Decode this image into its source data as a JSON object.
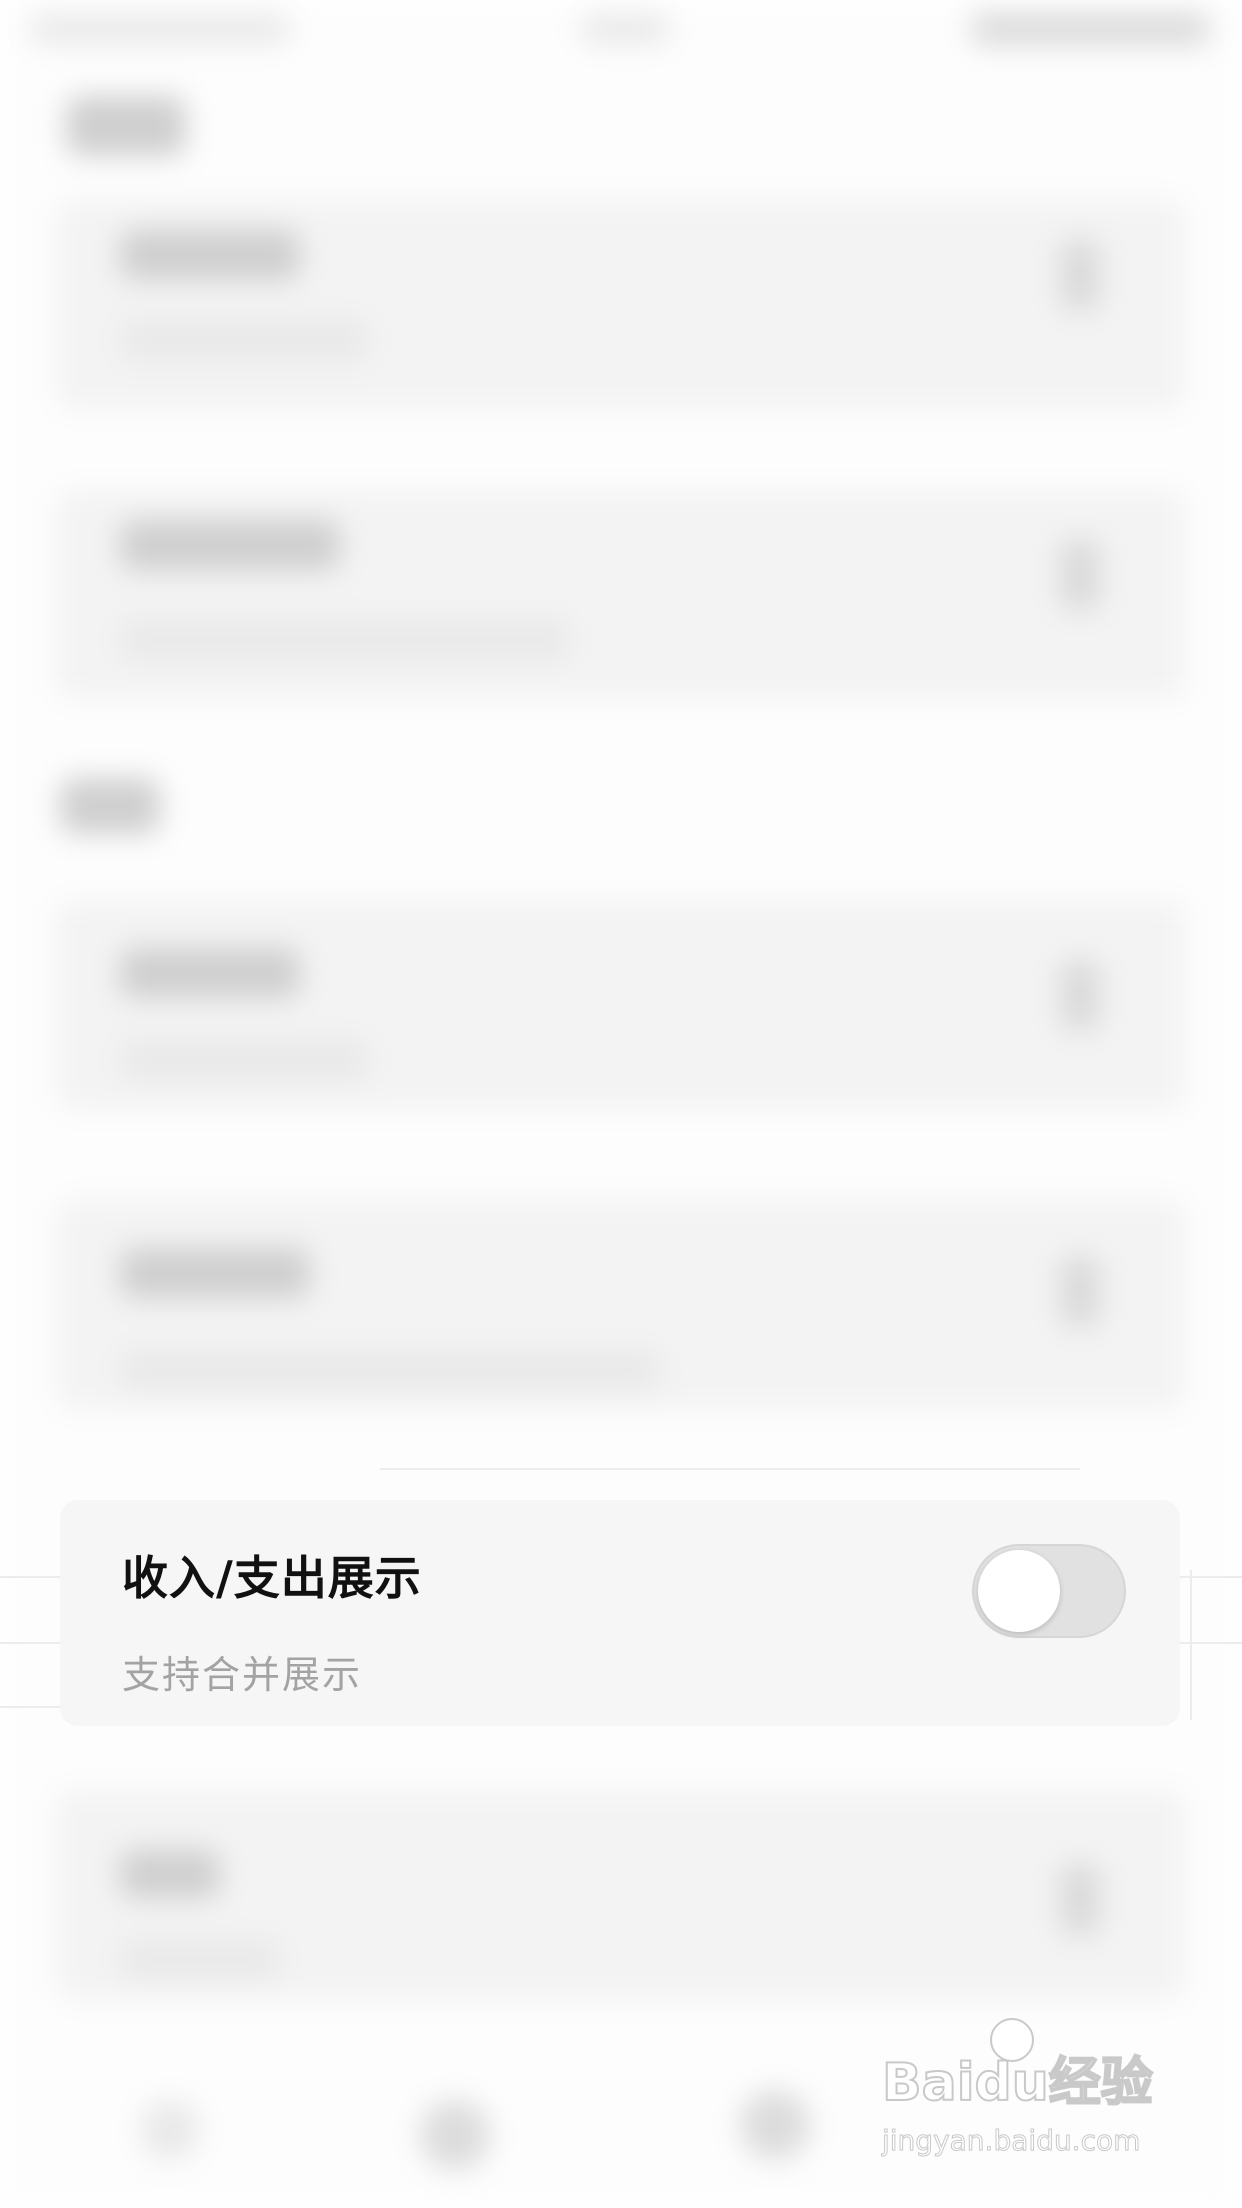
{
  "dialog_card": {
    "title": "收入/支出展示",
    "subtitle": "支持合并展示",
    "toggle_state": "off"
  },
  "watermark": {
    "logo_text": "Baidu经验",
    "url_text": "jingyan.baidu.com"
  },
  "colors": {
    "title": "#111111",
    "subtitle": "#a3a3a3",
    "toggle_track": "#e1e1e1",
    "toggle_knob": "#ffffff",
    "card_background": "#f6f6f6"
  }
}
